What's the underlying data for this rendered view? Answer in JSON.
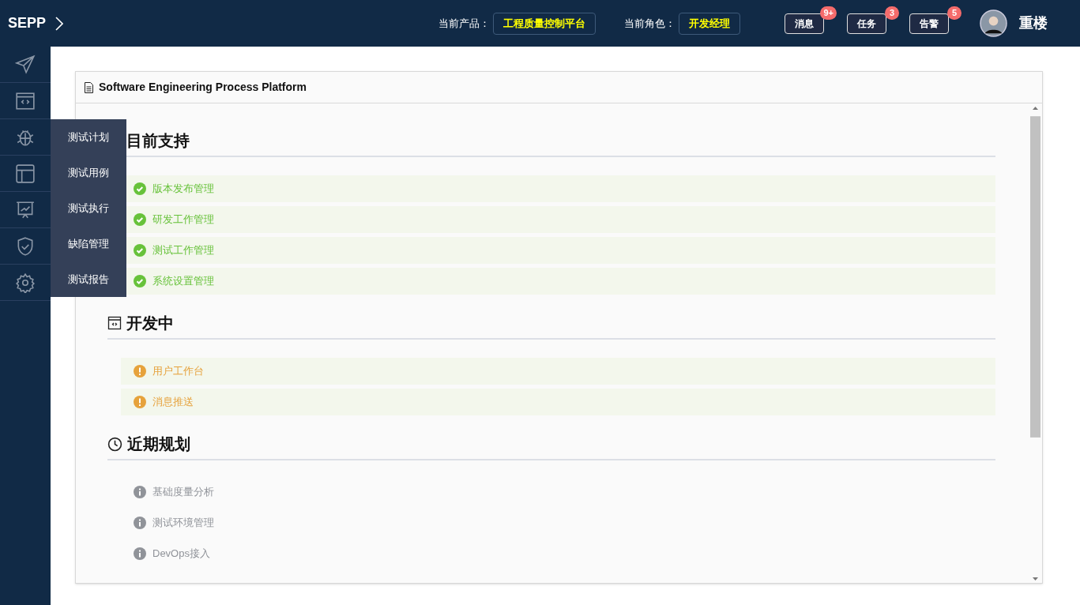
{
  "header": {
    "brand": "SEPP",
    "product_label": "当前产品：",
    "product": "工程质量控制平台",
    "role_label": "当前角色：",
    "role": "开发经理",
    "notices": [
      {
        "label": "消息",
        "count": "9+"
      },
      {
        "label": "任务",
        "count": "3"
      },
      {
        "label": "告警",
        "count": "5"
      }
    ],
    "user": "重楼"
  },
  "sidebar": {
    "flyout": [
      "测试计划",
      "测试用例",
      "测试执行",
      "缺陷管理",
      "测试报告"
    ]
  },
  "panel": {
    "title": "Software Engineering Process Platform",
    "sections": [
      {
        "kind": "done",
        "title": "目前支持",
        "items": [
          "版本发布管理",
          "研发工作管理",
          "测试工作管理",
          "系统设置管理"
        ]
      },
      {
        "kind": "dev",
        "title": "开发中",
        "items": [
          "用户工作台",
          "消息推送"
        ]
      },
      {
        "kind": "planned",
        "title": "近期规划",
        "items": [
          "基础度量分析",
          "测试环境管理",
          "DevOps接入"
        ]
      }
    ]
  }
}
